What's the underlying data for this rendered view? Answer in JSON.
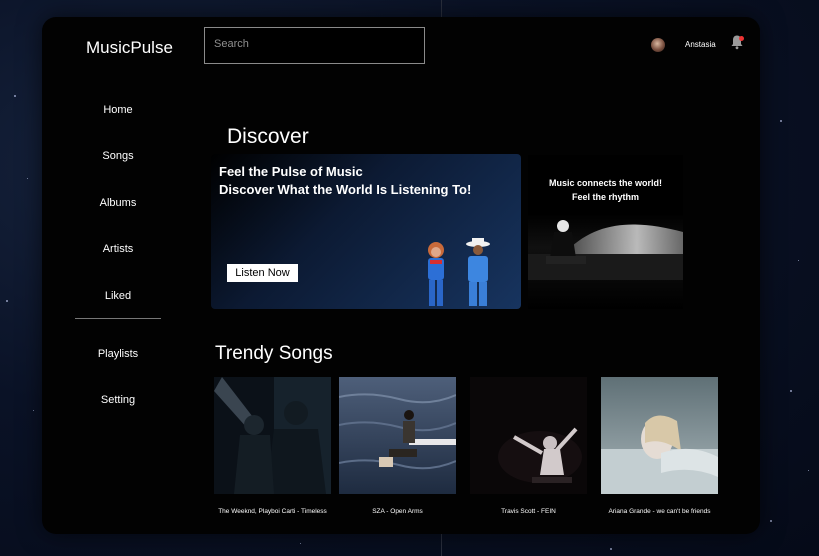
{
  "app": {
    "name": "MusicPulse"
  },
  "search": {
    "placeholder": "Search"
  },
  "user": {
    "name": "Anstasia",
    "avatar": "user-avatar",
    "notification_icon": "bell-icon",
    "notification_color": "#e33333"
  },
  "sidebar": {
    "items": [
      {
        "label": "Home"
      },
      {
        "label": "Songs"
      },
      {
        "label": "Albums"
      },
      {
        "label": "Artists"
      },
      {
        "label": "Liked"
      },
      {
        "label": "Playlists"
      },
      {
        "label": "Setting"
      }
    ]
  },
  "discover": {
    "title": "Discover",
    "hero": {
      "line1": "Feel the Pulse of Music",
      "line2": "Discover What the World Is Listening To!",
      "button": "Listen Now"
    },
    "promo": {
      "line1": "Music connects the world!",
      "line2": "Feel the rhythm"
    }
  },
  "trendy": {
    "title": "Trendy Songs",
    "songs": [
      {
        "title": "The Weeknd, Playboi Carti - Timeless"
      },
      {
        "title": "SZA - Open Arms"
      },
      {
        "title": "Travis Scott - FEIN"
      },
      {
        "title": "Ariana Grande - we can't be friends"
      }
    ]
  }
}
